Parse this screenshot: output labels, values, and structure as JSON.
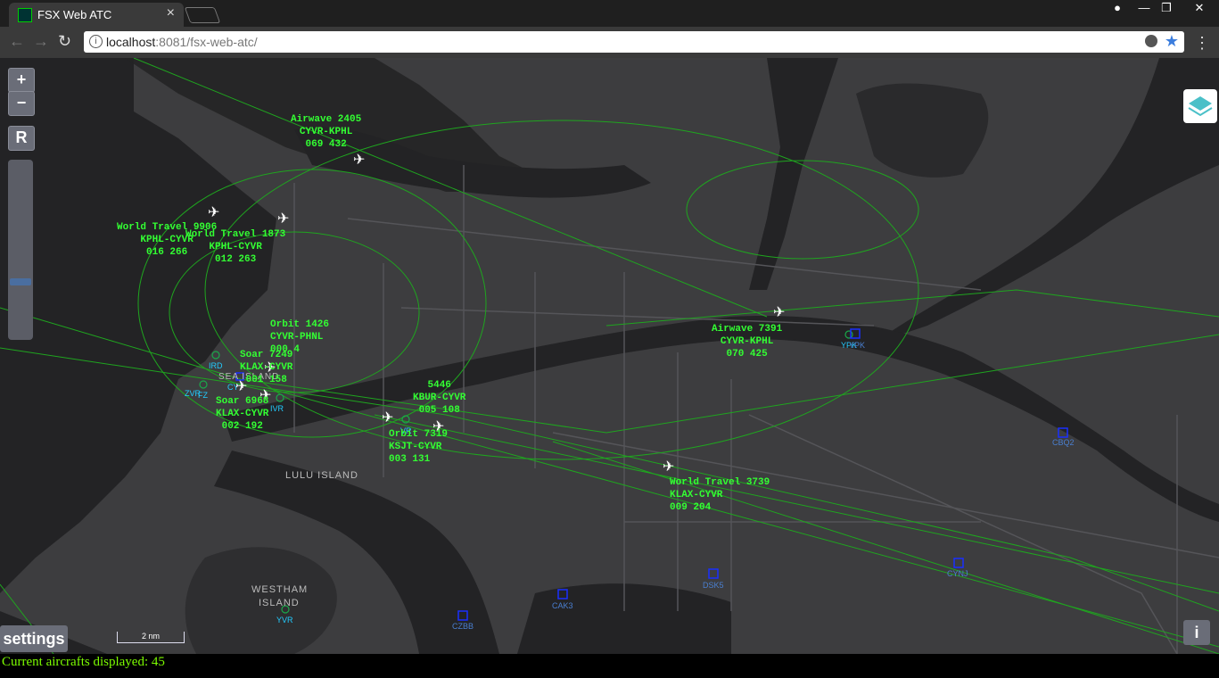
{
  "browser": {
    "tab_title": "FSX Web ATC",
    "url_host": "localhost",
    "url_rest": ":8081/fsx-web-atc/"
  },
  "map_controls": {
    "zoom_in": "+",
    "zoom_out": "−",
    "reset": "R",
    "settings": "settings",
    "info": "i",
    "scale": "2 nm"
  },
  "status": {
    "aircraft_count_text": "Current aircrafts displayed: 45"
  },
  "map_labels": {
    "lulu_island": "LULU ISLAND",
    "westham_1": "WESTHAM",
    "westham_2": "ISLAND",
    "sea_island": "SEA ISLAND"
  },
  "aircraft": [
    {
      "callsign": "Airwave 2405",
      "route": "CYVR-KPHL",
      "data": "069 432"
    },
    {
      "callsign": "World Travel 9906",
      "route": "KPHL-CYVR",
      "data": "016 266"
    },
    {
      "callsign": "World Travel 1873",
      "route": "KPHL-CYVR",
      "data": "012 263"
    },
    {
      "callsign": "Orbit 1426",
      "route": "CYVR-PHNL",
      "data": "000 4"
    },
    {
      "callsign": "Soar 7249",
      "route": "KLAX-CYVR",
      "data": "001 158"
    },
    {
      "callsign": "Soar 6968",
      "route": "KLAX-CYVR",
      "data": "002 192"
    },
    {
      "callsign": "5446",
      "route": "KBUR-CYVR",
      "data": "005 108"
    },
    {
      "callsign": "Orbit 7319",
      "route": "KSJT-CYVR",
      "data": "003 131"
    },
    {
      "callsign": "Airwave 7391",
      "route": "CYVR-KPHL",
      "data": "070 425"
    },
    {
      "callsign": "World Travel 3739",
      "route": "KLAX-CYVR",
      "data": "009 204"
    }
  ],
  "waypoints": [
    "IRD",
    "ZVR",
    "FZ",
    "IVR",
    "YVR",
    "VR",
    "YPK",
    "CY"
  ],
  "airports": [
    "CBQ2",
    "CYNJ",
    "DSK5",
    "CAK3",
    "CZBB",
    "YPK"
  ],
  "colors": {
    "map_bg": "#3d3d3f",
    "water": "#232325",
    "route": "#1fa51f",
    "label": "#33ff33",
    "footer_text": "#7cfc00"
  }
}
